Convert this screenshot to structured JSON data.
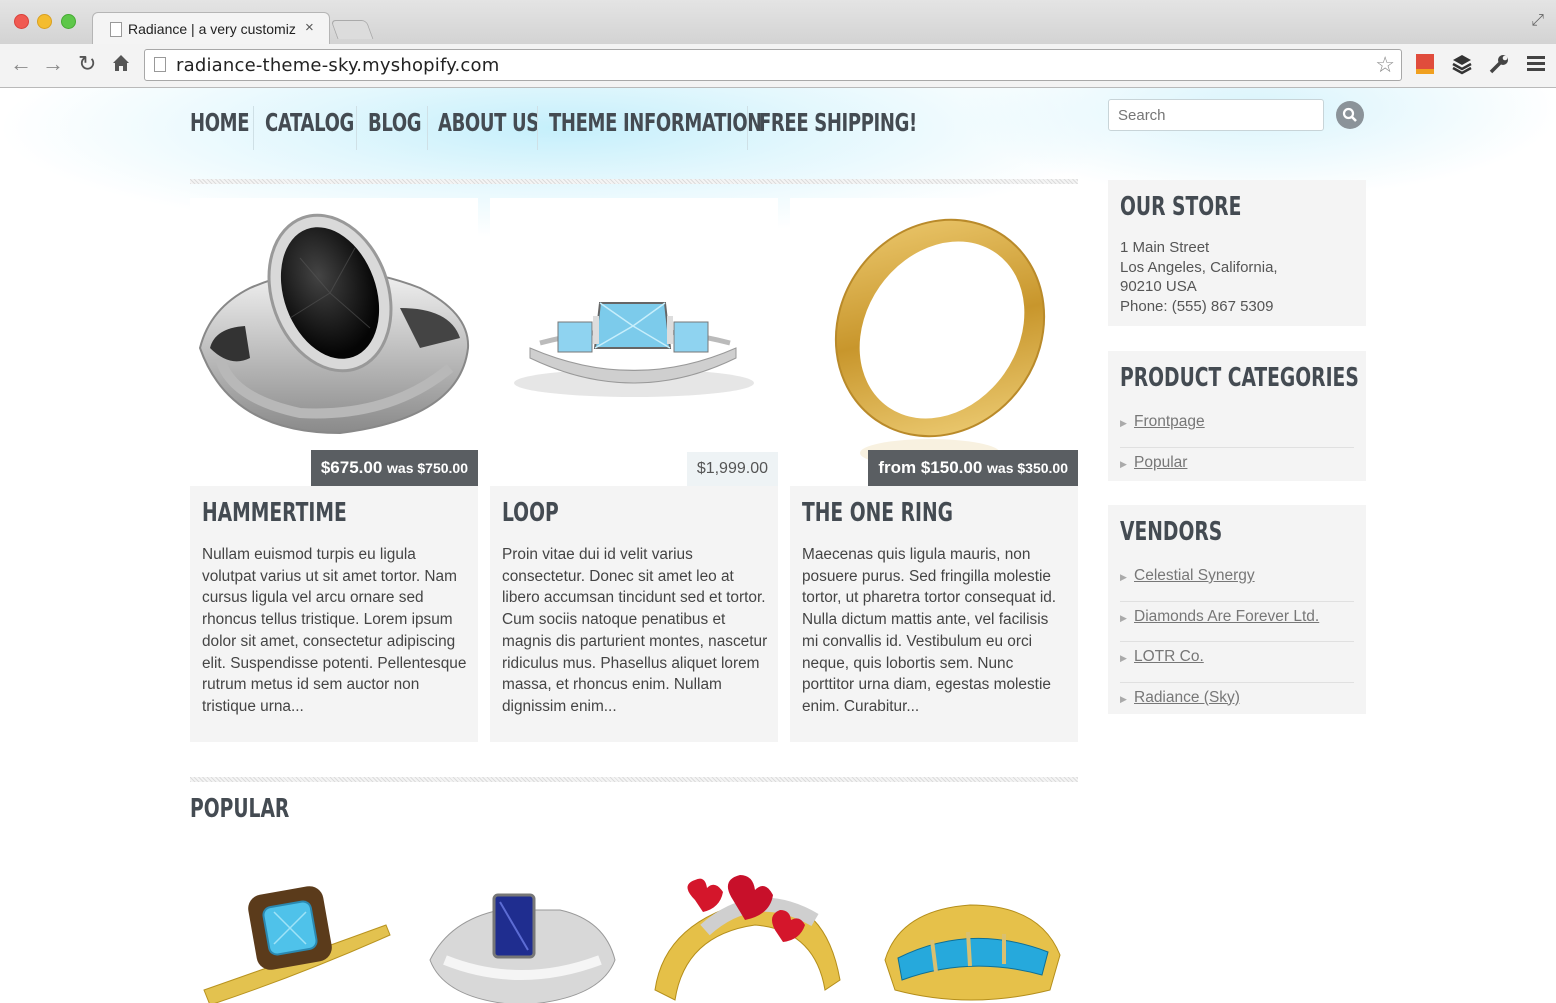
{
  "browser": {
    "tab_title": "Radiance | a very customiz",
    "tab_close": "×",
    "url": "radiance-theme-sky.myshopify.com"
  },
  "nav": {
    "items": [
      "HOME",
      "CATALOG",
      "BLOG",
      "ABOUT US",
      "THEME INFORMATION",
      "FREE SHIPPING!"
    ]
  },
  "search": {
    "placeholder": "Search"
  },
  "featured": [
    {
      "title": "HAMMERTIME",
      "price": "$675.00",
      "was": "was $750.00",
      "description": "Nullam euismod turpis eu ligula volutpat varius ut sit amet tortor. Nam cursus ligula vel arcu ornare sed rhoncus tellus tristique. Lorem ipsum dolor sit amet, consectetur adipiscing elit. Suspendisse potenti. Pellentesque rutrum metus id sem auctor non tristique urna..."
    },
    {
      "title": "LOOP",
      "price": "$1,999.00",
      "was": "",
      "description": "Proin vitae dui id velit varius consectetur.  Donec sit amet leo at libero accumsan tincidunt sed et tortor. Cum sociis natoque penatibus et magnis dis parturient montes, nascetur ridiculus mus. Phasellus aliquet lorem massa, et rhoncus enim. Nullam dignissim enim..."
    },
    {
      "title": "THE ONE RING",
      "price": "from $150.00",
      "was": "was $350.00",
      "description": "Maecenas quis ligula mauris, non posuere purus. Sed fringilla molestie tortor, ut pharetra tortor consequat id. Nulla dictum mattis ante, vel facilisis mi convallis id. Vestibulum eu orci neque, quis lobortis sem. Nunc porttitor urna diam, egestas molestie enim. Curabitur..."
    }
  ],
  "sidebar": {
    "store": {
      "title": "OUR STORE",
      "line1": "1 Main Street",
      "line2": "Los Angeles, California,",
      "line3": "90210 USA",
      "line4": "Phone: (555) 867 5309"
    },
    "categories": {
      "title": "PRODUCT CATEGORIES",
      "items": [
        "Frontpage",
        "Popular"
      ]
    },
    "vendors": {
      "title": "VENDORS",
      "items": [
        "Celestial Synergy",
        "Diamonds Are Forever Ltd.",
        "LOTR Co.",
        "Radiance (Sky)"
      ]
    }
  },
  "popular": {
    "title": "POPULAR"
  },
  "colors": {
    "heading": "#444b52",
    "price_tag": "#5a5e62",
    "panel_bg": "#f4f4f4",
    "glow": "#c5effb"
  }
}
